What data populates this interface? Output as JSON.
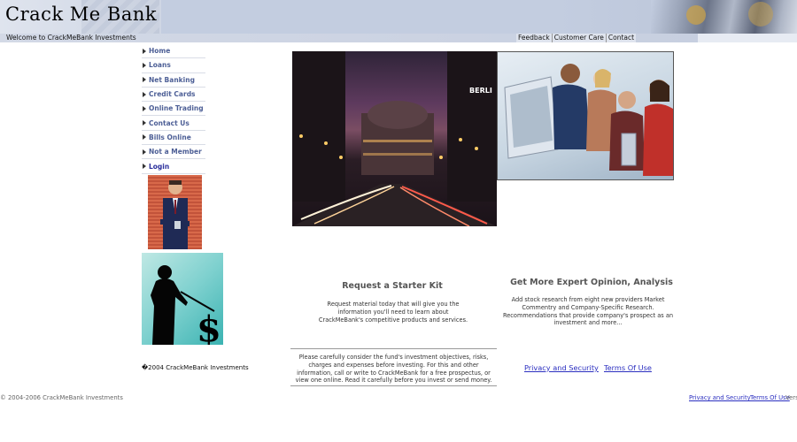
{
  "header": {
    "logo": "Crack Me Bank",
    "welcome": "Welcome to CrackMeBank Investments",
    "top_links": [
      "Feedback",
      "Customer Care",
      "Contact"
    ]
  },
  "sidebar": {
    "items": [
      {
        "label": "Home"
      },
      {
        "label": "Loans"
      },
      {
        "label": "Net Banking"
      },
      {
        "label": "Credit Cards"
      },
      {
        "label": "Online Trading"
      },
      {
        "label": "Contact Us"
      },
      {
        "label": "Bills Online"
      },
      {
        "label": "Not a Member"
      },
      {
        "label": "Login"
      }
    ]
  },
  "images": {
    "city_sign": "BERLI"
  },
  "starter_kit": {
    "title": "Request a Starter Kit",
    "text": "Request material today that will give you the information you'll need to learn about CrackMeBank's competitive products and services."
  },
  "expert": {
    "title": "Get More Expert Opinion, Analysis",
    "text": "Add stock research from eight new providers Market Commentry and Company-Specific Research. Recommendations that provide company's prospect as an investment and more..."
  },
  "disclaimer": "Please carefully consider the fund's investment objectives, risks, charges and expenses before investing. For this and other information, call or write to CrackMeBank for a free prospectus, or view one online. Read it carefully before you invest or send money.",
  "copyright_mid": "�2004 CrackMeBank Investments",
  "links_mid": {
    "privacy": "Privacy and Security",
    "terms": "Terms Of Use"
  },
  "footer": {
    "copyright": "© 2004-2006 CrackMeBank Investments",
    "privacy": "Privacy and Security",
    "terms": "Terms Of Use",
    "version": "Vers"
  },
  "colors": {
    "nav_link": "#4d5f96",
    "login_link": "#2b2f9c",
    "link": "#2b2fc0",
    "banner": "#c3cde0"
  }
}
